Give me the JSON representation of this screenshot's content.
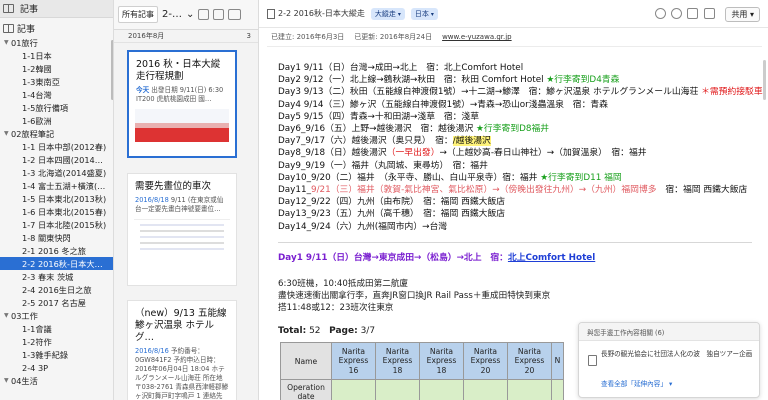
{
  "sidebar": {
    "header": "記事",
    "notes_label": "記事",
    "items": [
      {
        "label": "01旅行",
        "level": "group",
        "expanded": true
      },
      {
        "label": "1-1日本",
        "level": "item"
      },
      {
        "label": "1-2韓國",
        "level": "item"
      },
      {
        "label": "1-3東南亞",
        "level": "item"
      },
      {
        "label": "1-4台灣",
        "level": "item"
      },
      {
        "label": "1-5旅行備項",
        "level": "item"
      },
      {
        "label": "1-6歐洲",
        "level": "item"
      },
      {
        "label": "02旅程筆記",
        "level": "group",
        "expanded": true
      },
      {
        "label": "1-1 日本中部(2012春)",
        "level": "item"
      },
      {
        "label": "1-2 日本四國(2014…",
        "level": "item"
      },
      {
        "label": "1-3 北海道(2014盛夏)",
        "level": "item"
      },
      {
        "label": "1-4 富士五湖+橫濱(…",
        "level": "item"
      },
      {
        "label": "1-5 日本東北(2013秋)",
        "level": "item"
      },
      {
        "label": "1-6 日本東北(2015春)",
        "level": "item"
      },
      {
        "label": "1-7 日本北陸(2015秋)",
        "level": "item"
      },
      {
        "label": "1-8 關東快閃",
        "level": "item"
      },
      {
        "label": "2-1 2016 冬之旅",
        "level": "item"
      },
      {
        "label": "2-2 2016秋-日本大…",
        "level": "item",
        "selected": true
      },
      {
        "label": "2-3 春末 茨城",
        "level": "item"
      },
      {
        "label": "2-4 2016生日之旅",
        "level": "item"
      },
      {
        "label": "2-5 2017 名古屋",
        "level": "item"
      },
      {
        "label": "03工作",
        "level": "group",
        "expanded": true
      },
      {
        "label": "1-1會議",
        "level": "item"
      },
      {
        "label": "1-2符作",
        "level": "item"
      },
      {
        "label": "1-3雜手紀錄",
        "level": "item"
      },
      {
        "label": "2-4 3P",
        "level": "item"
      },
      {
        "label": "04生活",
        "level": "group",
        "expanded": true
      }
    ]
  },
  "notelist": {
    "filter": "所有記事",
    "sort": "2-…",
    "group_date": "2016年8月",
    "group_count": "3",
    "cards": [
      {
        "title": "2016 秋・日本大縱走行程規劃",
        "meta_date": "今天",
        "meta_rest": "出發日期 9/11(日) 6:30 IT200 虎航桃園成田 國…",
        "selected": true
      },
      {
        "title": "需要先畫位的車次",
        "meta_date": "2016/8/18",
        "meta_rest": "9/11 (在東京或仙台一定要先畫白神號要畫位…",
        "selected": false
      },
      {
        "title": "（new）9/13 五能線 鯵ヶ沢温泉 ホテルグ…",
        "meta_date": "2016/8/16",
        "meta_rest": "予約番号：0GW841F2 予約申込日時：2016年06月04日 18:04 ホテルグランメール山海荘 所在地 〒038-2761 青森県西津軽郡鯵ヶ沢町舞戸町字鳴戸 1 連絡先 0173-72-8112…",
        "selected": false
      }
    ]
  },
  "editor": {
    "title": "2-2 2016秋-日本大縱走",
    "tags": [
      "大縱走",
      "日本"
    ],
    "share": "共用",
    "created": "已建立: 2016年6月3日",
    "updated": "已更新: 2016年8月24日",
    "url": "www.e-yuzawa.gr.jp",
    "itinerary": [
      [
        {
          "t": "Day1 9/11（日）台灣→成田→北上　宿：北上Comfort Hotel",
          "c": ""
        }
      ],
      [
        {
          "t": "Day2 9/12（一）北上線→鶴秋湖→秋田　宿：秋田 Comfort Hotel",
          "c": ""
        },
        {
          "t": " ★行李寄到D4青森",
          "c": "green"
        }
      ],
      [
        {
          "t": "Day3 9/13（二）秋田（五能線白神渡假1號）→十二湖→鯵澤　宿：鯵ヶ沢温泉 ホテルグランメール山海荘",
          "c": ""
        },
        {
          "t": " ＊需預約接駁車",
          "c": "red"
        }
      ],
      [
        {
          "t": "Day4 9/14（三）鯵ヶ沢（五能線白神渡假1號）→青森→恐山or淺蟲溫泉　宿：青森",
          "c": ""
        }
      ],
      [
        {
          "t": "Day5 9/15（四）青森→十和田湖→淺草　宿：淺草",
          "c": ""
        }
      ],
      [
        {
          "t": "Day6_9/16（五）上野→越後湯沢　宿：越後湯沢",
          "c": ""
        },
        {
          "t": " ★行李寄到D8福井",
          "c": "green"
        }
      ],
      [
        {
          "t": "Day7_9/17（六）越後湯沢（奥只見）　宿：",
          "c": ""
        },
        {
          "t": "/越後湯沢",
          "c": "hl"
        }
      ],
      [
        {
          "t": "Day8_9/18（日）越後湯沢",
          "c": ""
        },
        {
          "t": "（一早出發）",
          "c": "red"
        },
        {
          "t": "→（上越妙高-春日山神社）→（加賀溫泉）　宿：福井",
          "c": ""
        }
      ],
      [
        {
          "t": "Day9_9/19（一）福井（丸岡城、東尋坊）　宿：福井",
          "c": ""
        }
      ],
      [
        {
          "t": "Day10_9/20（二）福井　（永平寺、勝山、白山平泉寺）宿：福井",
          "c": ""
        },
        {
          "t": " ★行李寄到D11 福岡",
          "c": "green"
        }
      ],
      [
        {
          "t": "Day11_",
          "c": ""
        },
        {
          "t": "9/21（三）福井（敦賀-氣比神宮、氣比松原）→（傍晚出發往九州）→（九州）福岡博多",
          "c": "salmon"
        },
        {
          "t": "　宿：福岡 西鐵大飯店",
          "c": ""
        }
      ],
      [
        {
          "t": "Day12_9/22（四）九州（由布院）　宿：福岡 西鐵大飯店",
          "c": ""
        }
      ],
      [
        {
          "t": "Day13_9/23（五）九州（高千穗）　宿：福岡 西鐵大飯店",
          "c": ""
        }
      ],
      [
        {
          "t": "Day14_9/24（六）九州(福岡市内）→台灣",
          "c": ""
        }
      ]
    ],
    "day1_heading": {
      "prefix": "Day1 9/11（日）台灣→東京成田→（松島）→北上　宿：",
      "link": "北上Comfort Hotel"
    },
    "notes": [
      "6:30班機，10:40抵成田第二航廈",
      "盡快速速衝出關拿行李，直奔JR窗口換JR Rail Pass＋重成田特快到東京",
      "搭11:48或12：23班次往東京"
    ],
    "total_label": "Total:",
    "total_value": "52",
    "page_label": "Page:",
    "page_value": "3/7",
    "table": {
      "header_name": "Name",
      "columns": [
        [
          "Narita",
          "Express",
          "16"
        ],
        [
          "Narita",
          "Express",
          "18"
        ],
        [
          "Narita",
          "Express",
          "18"
        ],
        [
          "Narita",
          "Express",
          "20"
        ],
        [
          "Narita",
          "Express",
          "20"
        ],
        [
          "N",
          "",
          ""
        ]
      ],
      "row_label_1": "Operation",
      "row_label_2": "date"
    }
  },
  "popup": {
    "title": "與您手邊工作內容相關 (6)",
    "desc": "長野の観光協会に社団法人化の波　独自ツアー企画",
    "link": "查看全部「延伸內容」"
  }
}
